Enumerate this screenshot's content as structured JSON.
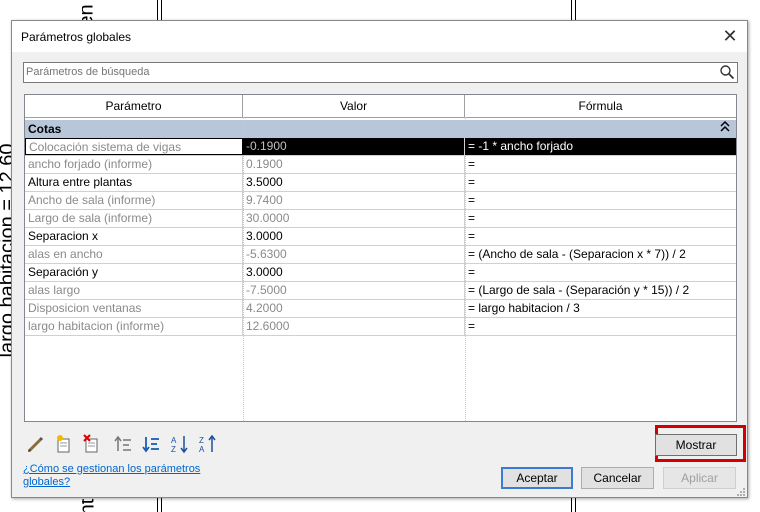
{
  "background": {
    "left_text": "largo habitacion = 12.60",
    "top_text": "en",
    "bottom_text": "nta"
  },
  "dialog": {
    "title": "Parámetros globales",
    "close_glyph": "✕"
  },
  "search": {
    "placeholder": "Parámetros de búsqueda",
    "icon": "search-icon"
  },
  "table": {
    "headers": [
      "Parámetro",
      "Valor",
      "Fórmula"
    ],
    "group": {
      "label": "Cotas",
      "toggle_glyph": "˄˄"
    },
    "rows": [
      {
        "name": "Colocación sistema de vigas",
        "value": "-0.1900",
        "formula": "= -1 * ancho forjado"
      },
      {
        "name": "ancho forjado (informe)",
        "value": "0.1900",
        "formula": "="
      },
      {
        "name": "Altura entre plantas",
        "value": "3.5000",
        "formula": "="
      },
      {
        "name": "Ancho de sala (informe)",
        "value": "9.7400",
        "formula": "="
      },
      {
        "name": "Largo de sala (informe)",
        "value": "30.0000",
        "formula": "="
      },
      {
        "name": "Separacion x",
        "value": "3.0000",
        "formula": "="
      },
      {
        "name": "alas en ancho",
        "value": "-5.6300",
        "formula": "= (Ancho de sala - (Separacion x * 7)) / 2"
      },
      {
        "name": "Separación y",
        "value": "3.0000",
        "formula": "="
      },
      {
        "name": "alas largo",
        "value": "-7.5000",
        "formula": "= (Largo de sala - (Separación y * 15)) / 2"
      },
      {
        "name": "Disposicion ventanas",
        "value": "4.2000",
        "formula": "= largo habitacion / 3"
      },
      {
        "name": "largo habitacion (informe)",
        "value": "12.6000",
        "formula": "="
      }
    ]
  },
  "toolbar": {
    "icons": [
      "edit-pencil-icon",
      "new-parameter-icon",
      "delete-parameter-icon",
      "move-up-icon",
      "move-down-icon",
      "sort-ascending-icon",
      "sort-descending-icon"
    ]
  },
  "buttons": {
    "mostrar": "Mostrar",
    "aceptar": "Aceptar",
    "cancelar": "Cancelar",
    "aplicar": "Aplicar"
  },
  "help_link": {
    "line1": "¿Cómo se gestionan los parámetros",
    "line2": "globales?"
  },
  "colors": {
    "highlight": "#d40000",
    "group_bg": "#b7c6d9",
    "link": "#0066cc"
  }
}
